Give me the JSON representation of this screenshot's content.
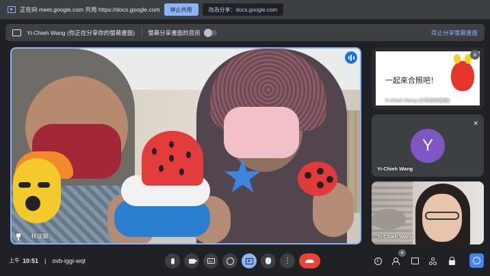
{
  "share_bar": {
    "message": "正在向 meet.google.com 共用 https://docs.google.com",
    "stop_label": "停止共用",
    "switch_label": "改為分享：docs.google.com"
  },
  "presenting_bar": {
    "title": "Yi-Chieh Wang (你正在分享你的螢幕畫面)",
    "audio_label": "螢幕分享畫面的音訊",
    "audio_enabled": false,
    "stop_label": "停止分享螢幕畫面"
  },
  "main_tile": {
    "participant_name": "林瑞蘭",
    "speaking": true
  },
  "side_tiles": [
    {
      "type": "presentation",
      "caption": "Yi-Chieh Wang (分享螢幕畫面)",
      "slide_text": "一起來合照吧！",
      "muted": true
    },
    {
      "type": "avatar",
      "initial": "Y",
      "name": "Yi-Chieh Wang",
      "muted": true,
      "avatar_color": "#7e57c2"
    },
    {
      "type": "video",
      "name": "Yi-Chieh Wang"
    }
  ],
  "bottom_bar": {
    "ampm": "上午",
    "time": "10:51",
    "meeting_code": "ovb-iggi-wqt",
    "people_count": "4",
    "controls": [
      "mic-icon",
      "camera-icon",
      "captions-icon",
      "emoji-icon",
      "present-icon",
      "raise-hand-icon",
      "more-options-icon",
      "end-call-icon"
    ],
    "right_controls": [
      "info-icon",
      "people-icon",
      "chat-icon",
      "activities-icon",
      "host-controls-icon",
      "clock-app-icon"
    ]
  },
  "colors": {
    "accent": "#8ab4f8",
    "end_call": "#ea4335",
    "bar_bg": "#3c4043",
    "page_bg": "#202124"
  }
}
